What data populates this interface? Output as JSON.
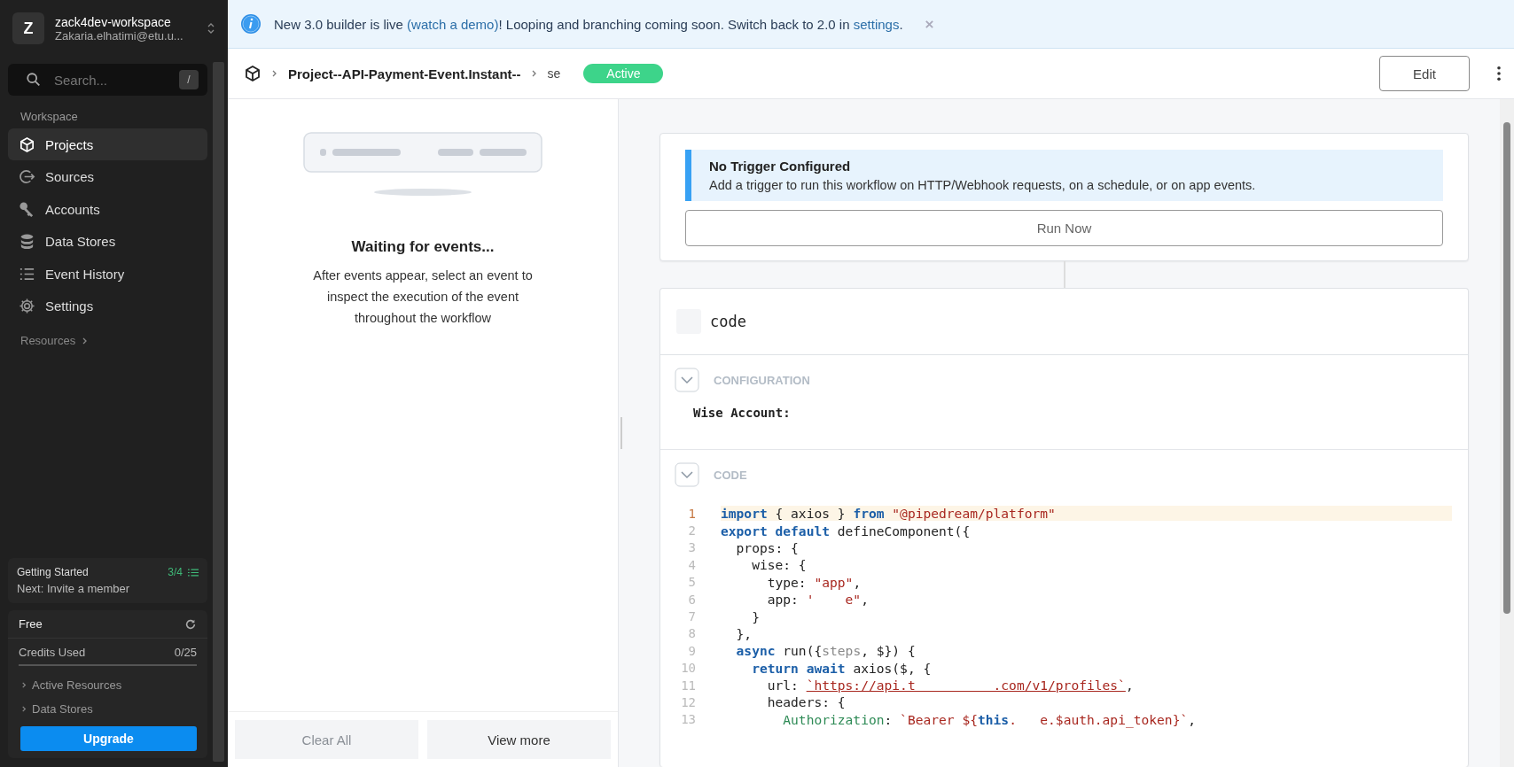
{
  "workspace": {
    "avatar": "Z",
    "name": "zack4dev-workspace",
    "email": "Zakaria.elhatimi@etu.u..."
  },
  "search": {
    "placeholder": "Search...",
    "shortcut": "/"
  },
  "sidebar": {
    "section": "Workspace",
    "resources": "Resources",
    "items": [
      {
        "label": "Projects",
        "kind": "cube",
        "selected": true
      },
      {
        "label": "Sources",
        "kind": "source",
        "selected": false
      },
      {
        "label": "Accounts",
        "kind": "key",
        "selected": false
      },
      {
        "label": "Data Stores",
        "kind": "database",
        "selected": false
      },
      {
        "label": "Event History",
        "kind": "list",
        "selected": false
      },
      {
        "label": "Settings",
        "kind": "gear",
        "selected": false
      }
    ]
  },
  "getting_started": {
    "title": "Getting Started",
    "progress": "3/4",
    "next": "Next: Invite a member"
  },
  "plan": {
    "name": "Free",
    "credits_label": "Credits Used",
    "credits": "0/25",
    "links": [
      "Active Resources",
      "Data Stores"
    ],
    "button": "Upgrade"
  },
  "banner": {
    "parts": [
      {
        "text": "New 3.0 builder is live ",
        "kind": "text"
      },
      {
        "text": "(watch a demo)",
        "kind": "link"
      },
      {
        "text": "! Looping and branching coming soon. Switch back to 2.0 in ",
        "kind": "text"
      },
      {
        "text": "settings",
        "kind": "link"
      },
      {
        "text": ".",
        "kind": "text"
      }
    ]
  },
  "breadcrumb": [
    "Project--API-Payment-Event.Instant--",
    "se"
  ],
  "status": "Active",
  "edit_button": "Edit",
  "events": {
    "title": "Waiting for events...",
    "description": "After events appear, select an event to inspect the execution of the event throughout the workflow",
    "buttons": [
      {
        "label": "Clear All",
        "disabled": true
      },
      {
        "label": "View more",
        "disabled": false
      }
    ]
  },
  "trigger": {
    "title": "No Trigger Configured",
    "text": "Add a trigger to run this workflow on HTTP/Webhook requests, on a schedule, or on app events.",
    "button": "Run Now"
  },
  "step": {
    "name": "code",
    "configuration": "CONFIGURATION",
    "field": "Wise Account:",
    "code_section": "CODE"
  },
  "code": [
    {
      "number": "1",
      "highlighted": true,
      "tokens": [
        {
          "text": "import",
          "kind": "kw"
        },
        {
          "text": " { axios } ",
          "kind": "plain"
        },
        {
          "text": "from",
          "kind": "kw"
        },
        {
          "text": " \"@pipedream/platform\"",
          "kind": "str"
        }
      ]
    },
    {
      "number": "2",
      "highlighted": false,
      "tokens": [
        {
          "text": "export default",
          "kind": "kw"
        },
        {
          "text": " defineComponent({",
          "kind": "plain"
        }
      ]
    },
    {
      "number": "3",
      "highlighted": false,
      "tokens": [
        {
          "text": "  props: {",
          "kind": "plain"
        }
      ]
    },
    {
      "number": "4",
      "highlighted": false,
      "tokens": [
        {
          "text": "    wise: {",
          "kind": "plain"
        }
      ]
    },
    {
      "number": "5",
      "highlighted": false,
      "tokens": [
        {
          "text": "      type: ",
          "kind": "plain"
        },
        {
          "text": "\"app\"",
          "kind": "str"
        },
        {
          "text": ",",
          "kind": "plain"
        }
      ]
    },
    {
      "number": "6",
      "highlighted": false,
      "tokens": [
        {
          "text": "      app: ",
          "kind": "plain"
        },
        {
          "text": "'    e\"",
          "kind": "str"
        },
        {
          "text": ",",
          "kind": "plain"
        }
      ]
    },
    {
      "number": "7",
      "highlighted": false,
      "tokens": [
        {
          "text": "    }",
          "kind": "plain"
        }
      ]
    },
    {
      "number": "8",
      "highlighted": false,
      "tokens": [
        {
          "text": "  },",
          "kind": "plain"
        }
      ]
    },
    {
      "number": "9",
      "highlighted": false,
      "tokens": [
        {
          "text": "  async",
          "kind": "kw"
        },
        {
          "text": " run({",
          "kind": "plain"
        },
        {
          "text": "steps",
          "kind": "param"
        },
        {
          "text": ", $}) {",
          "kind": "plain"
        }
      ]
    },
    {
      "number": "10",
      "highlighted": false,
      "tokens": [
        {
          "text": "    return await",
          "kind": "kw"
        },
        {
          "text": " axios($, {",
          "kind": "plain"
        }
      ]
    },
    {
      "number": "11",
      "highlighted": false,
      "tokens": [
        {
          "text": "      url: ",
          "kind": "plain"
        },
        {
          "text": "`https://api.t          .com/v1/profiles`",
          "kind": "url"
        },
        {
          "text": ",",
          "kind": "plain"
        }
      ]
    },
    {
      "number": "12",
      "highlighted": false,
      "tokens": [
        {
          "text": "      headers: {",
          "kind": "plain"
        }
      ]
    },
    {
      "number": "13",
      "highlighted": false,
      "tokens": [
        {
          "text": "        Authorization",
          "kind": "prop"
        },
        {
          "text": ": ",
          "kind": "plain"
        },
        {
          "text": "`Bearer ${",
          "kind": "str"
        },
        {
          "text": "this",
          "kind": "kw"
        },
        {
          "text": ".   e.$auth.api_token}`",
          "kind": "str"
        },
        {
          "text": ",",
          "kind": "plain"
        }
      ]
    }
  ]
}
